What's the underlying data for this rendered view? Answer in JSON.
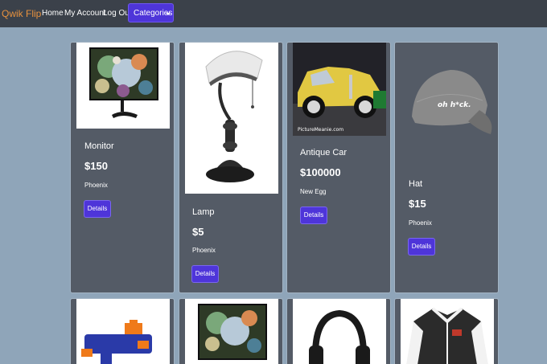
{
  "navbar": {
    "brand": "Qwik Flip",
    "links": [
      "Home",
      "My Account",
      "Log Out"
    ],
    "categories_label": "Categories"
  },
  "products": [
    {
      "title": "Monitor",
      "price": "$150",
      "location": "Phoenix",
      "button": "Details"
    },
    {
      "title": "Lamp",
      "price": "$5",
      "location": "Phoenix",
      "button": "Details"
    },
    {
      "title": "Antique Car",
      "price": "$100000",
      "location": "New Egg",
      "button": "Details"
    },
    {
      "title": "Hat",
      "price": "$15",
      "location": "Phoenix",
      "button": "Details"
    }
  ],
  "images": {
    "car_watermark": "PictureMeanie.com",
    "hat_text": "oh h*ck."
  },
  "colors": {
    "page_bg": "#8fa5b9",
    "navbar_bg": "#3b414a",
    "brand": "#e8923e",
    "card_bg": "#545b66",
    "button": "#4e35d9"
  },
  "icons": [
    "monitor-image",
    "lamp-image",
    "antique-car-image",
    "hat-image",
    "toy-blaster-image",
    "headphones-image",
    "varsity-jacket-image"
  ]
}
